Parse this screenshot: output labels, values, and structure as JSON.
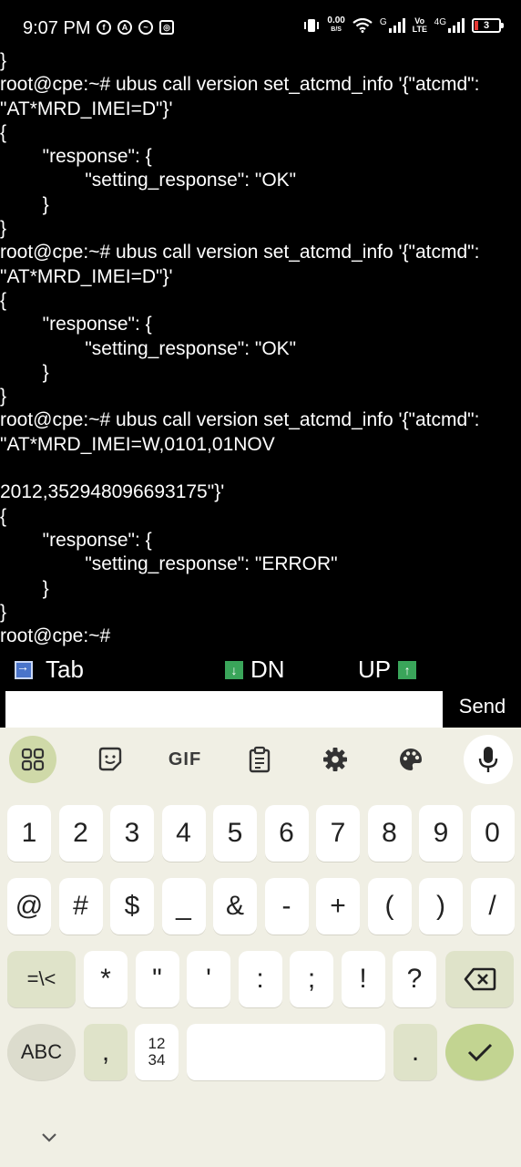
{
  "status_bar": {
    "time": "9:07 PM",
    "net_speed_value": "0.00",
    "net_speed_unit": "B/S",
    "network_g": "G",
    "volte": "Vo LTE",
    "network_4g": "4G",
    "battery_level": "3",
    "battery_color": "#e53935"
  },
  "terminal": {
    "lines": [
      "}",
      "root@cpe:~# ubus call version set_atcmd_info '{\"atcmd\":",
      "\"AT*MRD_IMEI=D\"}'",
      "{",
      "        \"response\": {",
      "                \"setting_response\": \"OK\"",
      "        }",
      "}",
      "root@cpe:~# ubus call version set_atcmd_info '{\"atcmd\":",
      "\"AT*MRD_IMEI=D\"}'",
      "{",
      "        \"response\": {",
      "                \"setting_response\": \"OK\"",
      "        }",
      "}",
      "root@cpe:~# ubus call version set_atcmd_info '{\"atcmd\":",
      "\"AT*MRD_IMEI=W,0101,01NOV",
      "",
      "2012,352948096693175\"}'",
      "{",
      "        \"response\": {",
      "                \"setting_response\": \"ERROR\"",
      "        }",
      "}",
      "root@cpe:~#"
    ]
  },
  "extra_keys": {
    "tab": "Tab",
    "down": "DN",
    "up": "UP"
  },
  "input": {
    "value": "",
    "send_label": "Send"
  },
  "keyboard": {
    "toolbar_gif": "GIF",
    "row1": [
      "1",
      "2",
      "3",
      "4",
      "5",
      "6",
      "7",
      "8",
      "9",
      "0"
    ],
    "row2": [
      "@",
      "#",
      "$",
      "_",
      "&",
      "-",
      "+",
      "(",
      ")",
      "/"
    ],
    "row3_left": "=\\<",
    "row3": [
      "*",
      "\"",
      "'",
      ":",
      ";",
      "!",
      "?"
    ],
    "row4_abc": "ABC",
    "row4_comma": ",",
    "row4_num_top": "12",
    "row4_num_bottom": "34",
    "row4_period": "."
  }
}
